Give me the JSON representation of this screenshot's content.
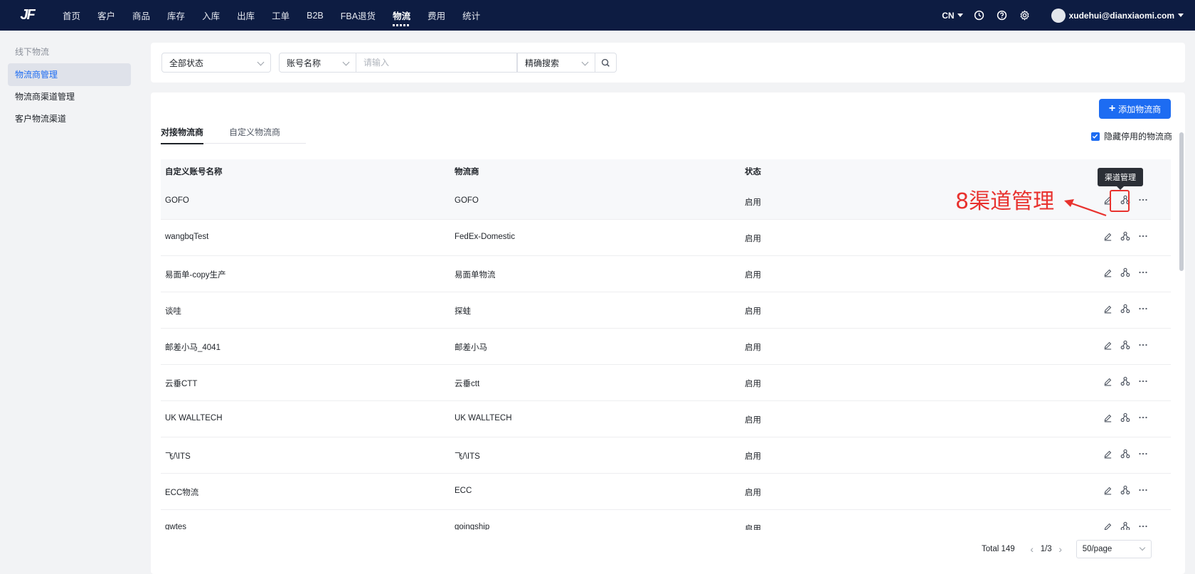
{
  "app": {
    "logo": "JF"
  },
  "nav": {
    "items": [
      "首页",
      "客户",
      "商品",
      "库存",
      "入库",
      "出库",
      "工单",
      "B2B",
      "FBA退货",
      "物流",
      "费用",
      "统计"
    ],
    "active_index": 9
  },
  "header": {
    "lang": "CN",
    "user_email": "xudehui@dianxiaomi.com"
  },
  "sidebar": {
    "group_title": "线下物流",
    "items": [
      "物流商管理",
      "物流商渠道管理",
      "客户物流渠道"
    ],
    "active_index": 0
  },
  "filters": {
    "status": "全部状态",
    "field": "账号名称",
    "keyword_placeholder": "请输入",
    "mode": "精确搜索"
  },
  "toolbar": {
    "add_label": "添加物流商",
    "hide_disabled_label": "隐藏停用的物流商",
    "hide_disabled_checked": true
  },
  "tabs": [
    "对接物流商",
    "自定义物流商"
  ],
  "table": {
    "columns": [
      "自定义账号名称",
      "物流商",
      "状态"
    ],
    "rows": [
      {
        "name": "GOFO",
        "carrier": "GOFO",
        "status": "启用"
      },
      {
        "name": "wangbqTest",
        "carrier": "FedEx-Domestic",
        "status": "启用"
      },
      {
        "name": "易面单-copy生产",
        "carrier": "易面单物流",
        "status": "启用"
      },
      {
        "name": "谈哇",
        "carrier": "探蛙",
        "status": "启用"
      },
      {
        "name": "邮差小马_4041",
        "carrier": "邮差小马",
        "status": "启用"
      },
      {
        "name": "云垂CTT",
        "carrier": "云垂ctt",
        "status": "启用"
      },
      {
        "name": "UK WALLTECH",
        "carrier": "UK WALLTECH",
        "status": "启用"
      },
      {
        "name": "飞/\\ITS",
        "carrier": "飞/\\ITS",
        "status": "启用"
      },
      {
        "name": "ECC物流",
        "carrier": "ECC",
        "status": "启用"
      },
      {
        "name": "gwtes",
        "carrier": "goingship",
        "status": "启用"
      }
    ]
  },
  "tooltip": {
    "text": "渠道管理"
  },
  "annotation": {
    "text": "8渠道管理",
    "color": "#e8322e"
  },
  "pagination": {
    "total": "Total 149",
    "page": "1/3",
    "page_size": "50/page"
  },
  "colors": {
    "nav_bg": "#0d1c42",
    "primary": "#1d6cf2"
  }
}
